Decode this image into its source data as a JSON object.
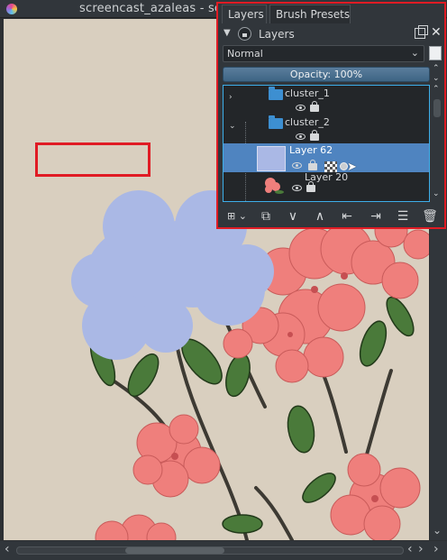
{
  "window": {
    "tab_title": "screencast_azaleas - sc",
    "tab_icon": "krita-icon"
  },
  "docker": {
    "tabs": [
      {
        "label": "Layers",
        "active": true
      },
      {
        "label": "Brush Presets",
        "active": false
      }
    ],
    "title": "Layers",
    "blend_mode": "Normal",
    "opacity_label": "Opacity:  100%",
    "layers": [
      {
        "name": "cluster_1",
        "type": "group",
        "visible": true,
        "locked": false,
        "expanded": false
      },
      {
        "name": "cluster_2",
        "type": "group",
        "visible": true,
        "locked": false,
        "expanded": true
      },
      {
        "name": "Layer 62",
        "type": "paint",
        "visible": true,
        "locked": false,
        "selected": true
      },
      {
        "name": "Layer 20",
        "type": "paint",
        "visible": true,
        "locked": false,
        "selected": false
      }
    ],
    "toolbar_buttons": [
      {
        "icon": "add-layer-icon"
      },
      {
        "icon": "duplicate-layer-icon"
      },
      {
        "icon": "move-down-icon"
      },
      {
        "icon": "move-up-icon"
      },
      {
        "icon": "properties-icon"
      },
      {
        "icon": "import-icon"
      },
      {
        "icon": "options-icon"
      },
      {
        "icon": "delete-icon"
      }
    ]
  },
  "colors": {
    "accent": "#3daee9",
    "highlight": "#e01b24",
    "selection": "#4f84c0",
    "canvas_bg": "#d9cfbf",
    "layer62_fill": "#aab8e5"
  }
}
